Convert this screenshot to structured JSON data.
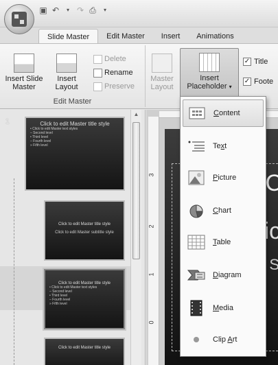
{
  "tabs": [
    "Slide Master",
    "Edit Master",
    "Insert",
    "Animations"
  ],
  "ribbon": {
    "edit_master": {
      "insert_slide_master": [
        "Insert Slide",
        "Master"
      ],
      "insert_layout": [
        "Insert",
        "Layout"
      ],
      "delete": "Delete",
      "rename": "Rename",
      "preserve": "Preserve",
      "group_label": "Edit Master"
    },
    "master_layout": {
      "master_layout": [
        "Master",
        "Layout"
      ],
      "insert_placeholder": [
        "Insert",
        "Placeholder"
      ],
      "title_checkbox": "Title",
      "footers_checkbox": "Foote"
    }
  },
  "thumbnails": {
    "slide_number": "1",
    "master": {
      "title": "Click to edit Master title style",
      "bullets": [
        "• Click to edit Master text styles",
        "  – Second level",
        "    • Third level",
        "      – Fourth level",
        "        » Fifth level"
      ]
    },
    "layout_title": {
      "title": "Click to edit Master title style",
      "subtitle": "Click to edit Master subtitle style"
    },
    "layout_content": {
      "title": "Click to edit Master title style",
      "bullets": [
        "• Click to edit Master text styles",
        "  – Second level",
        "    • Third level",
        "      – Fourth level",
        "        » Fifth level"
      ]
    },
    "layout_4": {
      "title": "Click to edit Master title style"
    }
  },
  "editor": {
    "ruler_marks": [
      "3",
      "2",
      "1",
      "0"
    ],
    "slide_text": [
      "C",
      "lic",
      "- S"
    ]
  },
  "menu": {
    "items": [
      {
        "label": "Content",
        "access": "C",
        "rest": "ontent",
        "icon": "content-icon"
      },
      {
        "label": "Text",
        "access": "x",
        "pre": "Te",
        "rest": "t",
        "icon": "text-icon"
      },
      {
        "label": "Picture",
        "access": "P",
        "rest": "icture",
        "icon": "picture-icon"
      },
      {
        "label": "Chart",
        "access": "C",
        "rest": "hart",
        "icon": "chart-icon"
      },
      {
        "label": "Table",
        "access": "T",
        "rest": "able",
        "icon": "table-icon"
      },
      {
        "label": "Diagram",
        "access": "D",
        "rest": "iagram",
        "icon": "diagram-icon"
      },
      {
        "label": "Media",
        "access": "M",
        "rest": "edia",
        "icon": "media-icon"
      },
      {
        "label": "Clip Art",
        "pre": "Clip ",
        "access": "A",
        "rest": "rt",
        "icon": "clip-art-icon"
      }
    ]
  }
}
